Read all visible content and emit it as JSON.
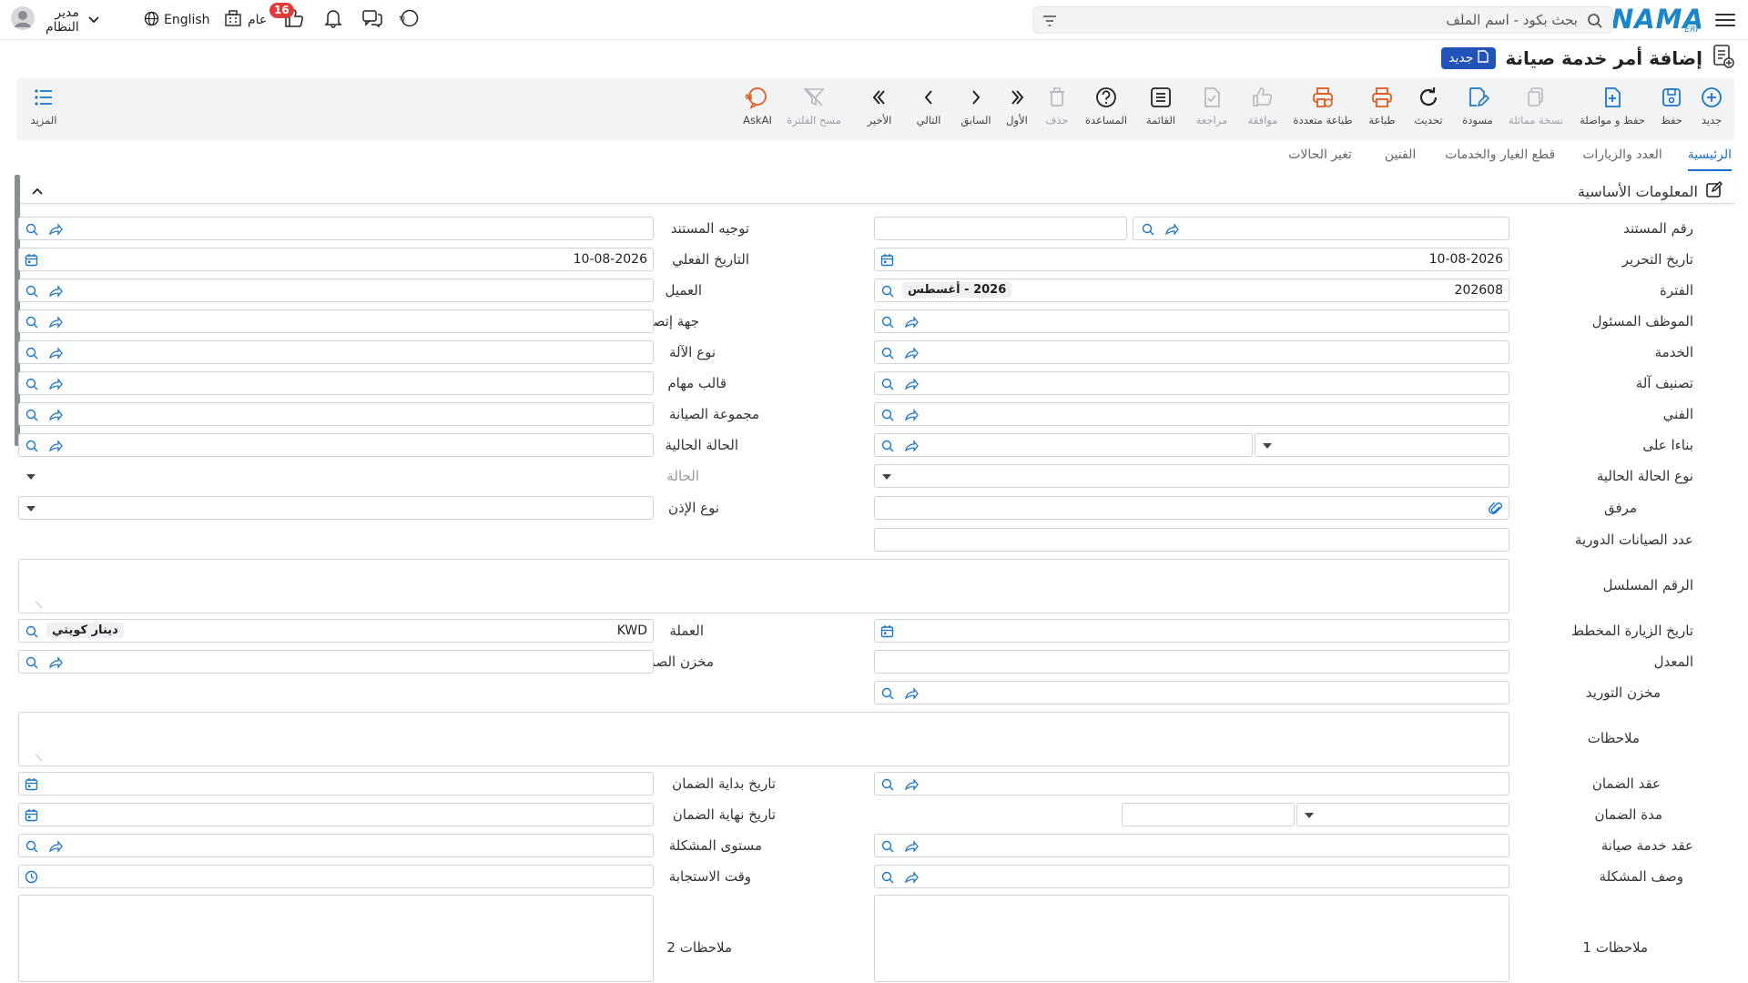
{
  "topbar": {
    "logo_text": "NAMA",
    "logo_sub": "ERP",
    "search_placeholder": "بحث بكود - اسم الملف",
    "user_name": "مدير النظام",
    "language": "English",
    "general": "عام",
    "notifications_count": "16"
  },
  "header": {
    "title": "إضافة أمر خدمة صيانة",
    "status_badge": "جديد"
  },
  "toolbar": {
    "new": "جديد",
    "save": "حفظ",
    "save_continue": "حفظ و مواصلة",
    "copy": "نسخة مماثلة",
    "draft": "مسودة",
    "refresh": "تحديث",
    "print": "طباعة",
    "multi_print": "طباعة متعددة",
    "approve": "موافقة",
    "review": "مراجعة",
    "list": "القائمة",
    "help": "المساعدة",
    "delete": "حذف",
    "first": "الأول",
    "previous": "السابق",
    "next": "التالي",
    "last": "الأخير",
    "clear_filter": "مسح الفلترة",
    "askai": "AskAI",
    "more": "المزيد"
  },
  "tabs": [
    "الرئيسية",
    "العدد والزيارات",
    "قطع الغيار والخدمات",
    "الفنين",
    "تغير الحالات"
  ],
  "section": {
    "title": "المعلومات الأساسية"
  },
  "form": {
    "doc_number": "رقم المستند",
    "doc_direction": "توجيه المستند",
    "edit_date": "تاريخ التحرير",
    "edit_date_value": "10-08-2026",
    "actual_date": "التاريخ الفعلي",
    "actual_date_value": "10-08-2026",
    "period": "الفترة",
    "period_value": "202608",
    "period_chip": "2026 - أغسطس",
    "customer": "العميل",
    "responsible": "الموظف المسئول",
    "contact": "جهة إتصال",
    "service": "الخدمة",
    "machine_type": "نوع الآلة",
    "machine_class": "تصنيف آلة",
    "task_template": "قالب مهام",
    "technician": "الفني",
    "maintenance_group": "مجموعة الصيانة",
    "based_on": "بناءا على",
    "current_status": "الحالة الحالية",
    "current_status_type": "نوع الحالة الحالية",
    "status": "الحالة",
    "attachment": "مرفق",
    "permission_type": "نوع الإذن",
    "periodic_count": "عدد الصيانات الدورية",
    "serial_number": "الرقم المسلسل",
    "planned_visit_date": "تاريخ الزيارة المخطط",
    "currency": "العملة",
    "currency_value": "KWD",
    "currency_chip": "دينار كويتي",
    "rate": "المعدل",
    "issue_store": "مخزن الصرف",
    "supply_store": "مخزن التوريد",
    "notes": "ملاحظات",
    "warranty_contract": "عقد الضمان",
    "warranty_start": "تاريخ بداية الضمان",
    "warranty_period": "مدة الضمان",
    "warranty_end": "تاريخ نهاية الضمان",
    "maintenance_contract": "عقد خدمة صيانة",
    "problem_level": "مستوى المشكلة",
    "problem_desc": "وصف المشكلة",
    "response_time": "وقت الاستجابة",
    "notes1": "ملاحظات 1",
    "notes2": "ملاحظات 2"
  }
}
